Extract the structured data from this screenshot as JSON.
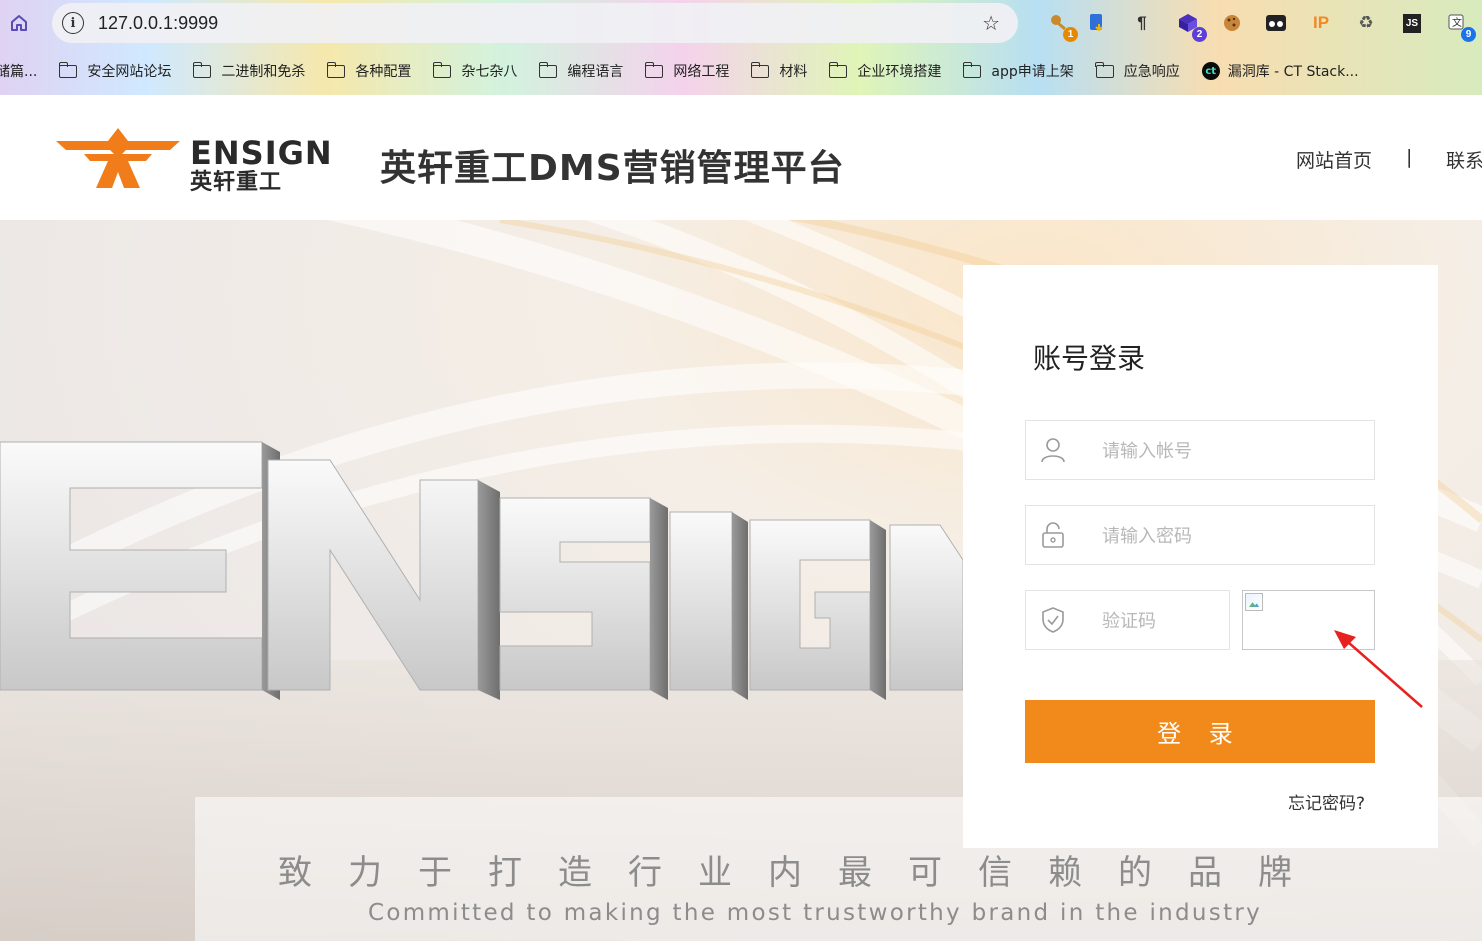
{
  "browser": {
    "url": "127.0.0.1:9999",
    "extensions": [
      {
        "name": "key-extension-icon",
        "badge": "1",
        "badge_color": "#e58a00"
      },
      {
        "name": "download-extension-icon",
        "badge": ""
      },
      {
        "name": "paragraph-extension-icon",
        "badge": ""
      },
      {
        "name": "cube-extension-icon",
        "badge": "2",
        "badge_color": "#5b3fd6"
      },
      {
        "name": "cookie-extension-icon",
        "badge": ""
      },
      {
        "name": "glasses-extension-icon",
        "badge": ""
      },
      {
        "name": "ip-extension-icon",
        "label": "IP",
        "badge": ""
      },
      {
        "name": "recycle-extension-icon",
        "badge": ""
      },
      {
        "name": "js-extension-icon",
        "label": "JS",
        "badge": ""
      },
      {
        "name": "translate-extension-icon",
        "badge": "9",
        "badge_color": "#1a73e8"
      }
    ],
    "bookmarks": [
      {
        "label": "储篇...",
        "type": "link"
      },
      {
        "label": "安全网站论坛",
        "type": "folder"
      },
      {
        "label": "二进制和免杀",
        "type": "folder"
      },
      {
        "label": "各种配置",
        "type": "folder"
      },
      {
        "label": "杂七杂八",
        "type": "folder"
      },
      {
        "label": "编程语言",
        "type": "folder"
      },
      {
        "label": "网络工程",
        "type": "folder"
      },
      {
        "label": "材料",
        "type": "folder"
      },
      {
        "label": "企业环境搭建",
        "type": "folder"
      },
      {
        "label": "app申请上架",
        "type": "folder"
      },
      {
        "label": "应急响应",
        "type": "folder"
      },
      {
        "label": "漏洞库 - CT Stack...",
        "type": "site"
      }
    ]
  },
  "header": {
    "logo_en": "ENSIGN",
    "logo_cn": "英轩重工",
    "site_title": "英轩重工DMS营销管理平台",
    "nav_home": "网站首页",
    "nav_separator": "|",
    "nav_contact": "联系"
  },
  "hero": {
    "slogan_cn": "致力于打造行业内最可信赖的品牌",
    "slogan_en": "Committed to making the most  trustworthy brand in the industry"
  },
  "login": {
    "title": "账号登录",
    "username_placeholder": "请输入帐号",
    "password_placeholder": "请输入密码",
    "captcha_placeholder": "验证码",
    "submit_label": "登 录",
    "forgot_label": "忘记密码?"
  },
  "colors": {
    "brand_orange": "#f28a1b",
    "annotation_red": "#e8201e"
  }
}
